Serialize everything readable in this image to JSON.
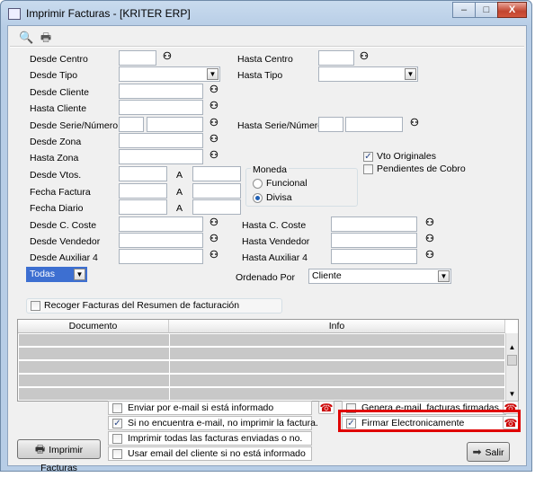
{
  "window": {
    "title": "Imprimir Facturas - [KRITER ERP]",
    "min_label": "–",
    "max_label": "□",
    "close_label": "X"
  },
  "toolbar": {
    "icons": [
      "print-preview-icon",
      "printer-icon"
    ]
  },
  "labels": {
    "desde_centro": "Desde Centro",
    "hasta_centro": "Hasta Centro",
    "desde_tipo": "Desde Tipo",
    "hasta_tipo": "Hasta Tipo",
    "desde_cliente": "Desde Cliente",
    "hasta_cliente": "Hasta Cliente",
    "desde_serie": "Desde Serie/Número",
    "hasta_serie": "Hasta Serie/Número",
    "desde_zona": "Desde Zona",
    "hasta_zona": "Hasta Zona",
    "desde_vtos": "Desde Vtos.",
    "fecha_factura": "Fecha Factura",
    "fecha_diario": "Fecha Diario",
    "a1": "A",
    "a2": "A",
    "a3": "A",
    "desde_coste": "Desde C. Coste",
    "hasta_coste": "Hasta C. Coste",
    "desde_vendedor": "Desde Vendedor",
    "hasta_vendedor": "Hasta Vendedor",
    "desde_aux4": "Desde Auxiliar 4",
    "hasta_aux4": "Hasta Auxiliar 4",
    "ordenado_por": "Ordenado Por"
  },
  "moneda": {
    "title": "Moneda",
    "funcional": "Funcional",
    "divisa": "Divisa",
    "selected": "Divisa"
  },
  "checks": {
    "vto_originales": {
      "label": "Vto Originales",
      "checked": true
    },
    "pendientes_cobro": {
      "label": "Pendientes de Cobro",
      "checked": false
    },
    "recoger": {
      "label": "Recoger Facturas del Resumen de facturación",
      "checked": false
    }
  },
  "todas_combo": {
    "value": "Todas"
  },
  "ordenado_combo": {
    "value": "Cliente"
  },
  "grid": {
    "columns": [
      "Documento",
      "Info"
    ],
    "rows": 6
  },
  "bottom_options": [
    {
      "label": "Enviar por e-mail si está informado",
      "checked": false
    },
    {
      "label": "Si no encuentra e-mail, no imprimir la factura.",
      "checked": true
    },
    {
      "label": "Imprimir todas las facturas enviadas o no.",
      "checked": false
    },
    {
      "label": "Usar email del cliente si no está informado",
      "checked": false
    }
  ],
  "right_options": [
    {
      "label": "Genera e-mail. facturas firmadas.",
      "checked": false
    },
    {
      "label": "Firmar Electronicamente",
      "checked": true
    }
  ],
  "buttons": {
    "imprimir": "Imprimir Facturas",
    "salir": "Salir"
  },
  "colors": {
    "highlight": "#e00000",
    "title_bg": "#c9dbee",
    "grid_row": "#c8c8c8"
  }
}
